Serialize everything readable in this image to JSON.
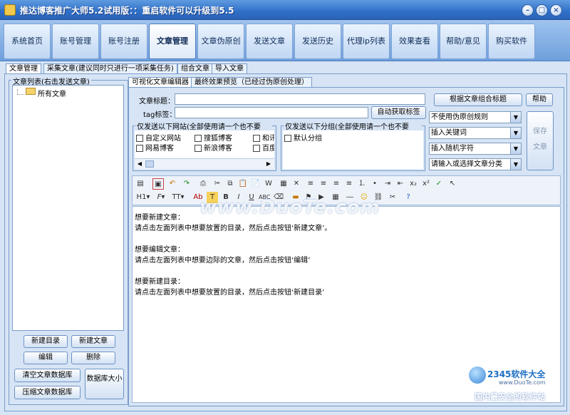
{
  "window": {
    "title": "推达博客推广大师5.2试用版：：重启软件可以升级到5.5"
  },
  "nav": {
    "tabs": [
      {
        "label": "系统首页"
      },
      {
        "label": "账号管理"
      },
      {
        "label": "账号注册"
      },
      {
        "label": "文章管理"
      },
      {
        "label": "文章伪原创"
      },
      {
        "label": "发送文章"
      },
      {
        "label": "发送历史"
      },
      {
        "label": "代理ip列表"
      },
      {
        "label": "效果查看"
      },
      {
        "label": "帮助/意见"
      },
      {
        "label": "购买软件"
      }
    ],
    "active": "文章管理"
  },
  "subtabs": [
    {
      "label": "文章管理"
    },
    {
      "label": "采集文章(建议同时只进行一项采集任务)"
    },
    {
      "label": "组合文章"
    },
    {
      "label": "导入文章"
    }
  ],
  "article_list": {
    "group_label": "文章列表(右击发送文章)",
    "root_label": "所有文章",
    "buttons": {
      "new_dir": "新建目录",
      "new_article": "新建文章",
      "edit": "编辑",
      "delete": "删除",
      "clear_db": "清空文章数据库",
      "compress_db": "压缩文章数据库",
      "db_size": "数据库大小"
    }
  },
  "editor_tabs": [
    {
      "label": "可视化文章编辑器"
    },
    {
      "label": "最终效果预览（已经过伪原创处理）"
    }
  ],
  "form": {
    "title_label": "文章标题：",
    "tag_label": "tag标签：",
    "auto_tag_button": "自动获取标签",
    "combine_title_button": "根据文章组合标题",
    "help_button": "帮助",
    "save_button": "保存文章",
    "sites_group_label": "仅发送以下网站(全部使用请一个也不要",
    "groups_group_label": "仅发送以下分组(全部使用请一个也不要",
    "sites": [
      "自定义网站",
      "搜狐博客",
      "和讯",
      "网易博客",
      "新浪博客",
      "百度"
    ],
    "groups": [
      "默认分组"
    ],
    "selects": {
      "pseudo_rule": "不使用伪原创规则",
      "insert_keyword": "插入关键词",
      "insert_random": "插入随机字符",
      "category": "请输入或选择文章分类"
    }
  },
  "editor_content": {
    "lines": [
      "想要新建文章：",
      "请点击左面列表中想要放置的目录，然后点击按钮‘新建文章’。",
      "",
      "想要编辑文章：",
      "请点击左面列表中想要边际的文章，然后点击按钮‘编辑’",
      "",
      "想要新建目录：",
      "请点击左面列表中想要放置的目录，然后点击按钮‘新建目录’"
    ]
  },
  "watermarks": {
    "duote": "www.DuoTe.com",
    "brand": "2345软件大全",
    "brand_url": "www.DuoTe.com",
    "slogan": "国内最安全的软件站"
  },
  "colors": {
    "titlebar": "#2f6fc7",
    "nav_bg": "#9fc3ee",
    "panel_bg": "#d6e4f5",
    "border": "#7a9cc9"
  }
}
